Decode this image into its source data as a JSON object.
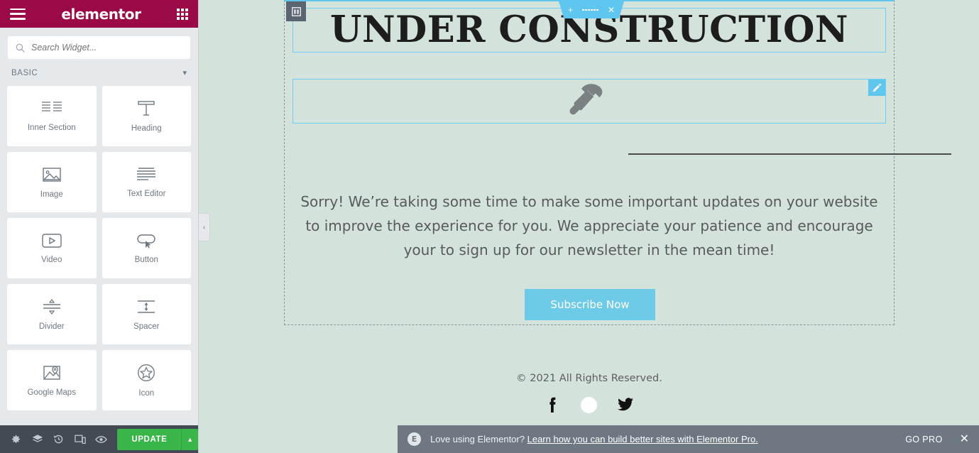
{
  "panel": {
    "header": {
      "logo": "elementor",
      "menu_icon": "hamburger-icon",
      "apps_icon": "grid-apps-icon"
    },
    "search": {
      "placeholder": "Search Widget...",
      "value": ""
    },
    "category": {
      "label": "BASIC",
      "chevron": "▾"
    },
    "widgets": [
      {
        "label": "Inner Section",
        "icon": "inner-section-icon"
      },
      {
        "label": "Heading",
        "icon": "heading-icon"
      },
      {
        "label": "Image",
        "icon": "image-icon"
      },
      {
        "label": "Text Editor",
        "icon": "text-editor-icon"
      },
      {
        "label": "Video",
        "icon": "video-icon"
      },
      {
        "label": "Button",
        "icon": "button-icon"
      },
      {
        "label": "Divider",
        "icon": "divider-icon"
      },
      {
        "label": "Spacer",
        "icon": "spacer-icon"
      },
      {
        "label": "Google Maps",
        "icon": "google-maps-icon"
      },
      {
        "label": "Icon",
        "icon": "star-icon"
      }
    ],
    "footer": {
      "icons": [
        "settings-gear-icon",
        "navigator-layers-icon",
        "history-icon",
        "responsive-mode-icon",
        "preview-eye-icon"
      ],
      "update_label": "UPDATE",
      "update_caret": "▲"
    }
  },
  "canvas": {
    "collapse_arrow": "‹",
    "section_toolbar": {
      "add": "+",
      "drag": "drag-dots",
      "close": "✕"
    },
    "heading": "UNDER CONSTRUCTION",
    "widget_icon": "hammer-icon",
    "edit_badge": "pencil-icon",
    "body_text": "Sorry! We’re taking some time to make some important updates on your website to improve the experience for you. We appreciate your patience and encourage your to sign up for our newsletter in the mean time!",
    "subscribe_label": "Subscribe Now",
    "copyright": "© 2021 All Rights Reserved.",
    "socials": [
      "facebook-icon",
      "instagram-icon",
      "twitter-icon"
    ]
  },
  "notice": {
    "badge": "E",
    "text": "Love using Elementor?",
    "link": "Learn how you can build better sites with Elementor Pro.",
    "go_pro": "GO PRO",
    "close": "✕"
  },
  "colors": {
    "brand": "#9b0a46",
    "accent_blue": "#5ec6ef",
    "update_green": "#39b54a",
    "canvas_bg": "#d4e2dc",
    "panel_bg": "#e6e9ec",
    "notice_bg": "#6d7882"
  }
}
